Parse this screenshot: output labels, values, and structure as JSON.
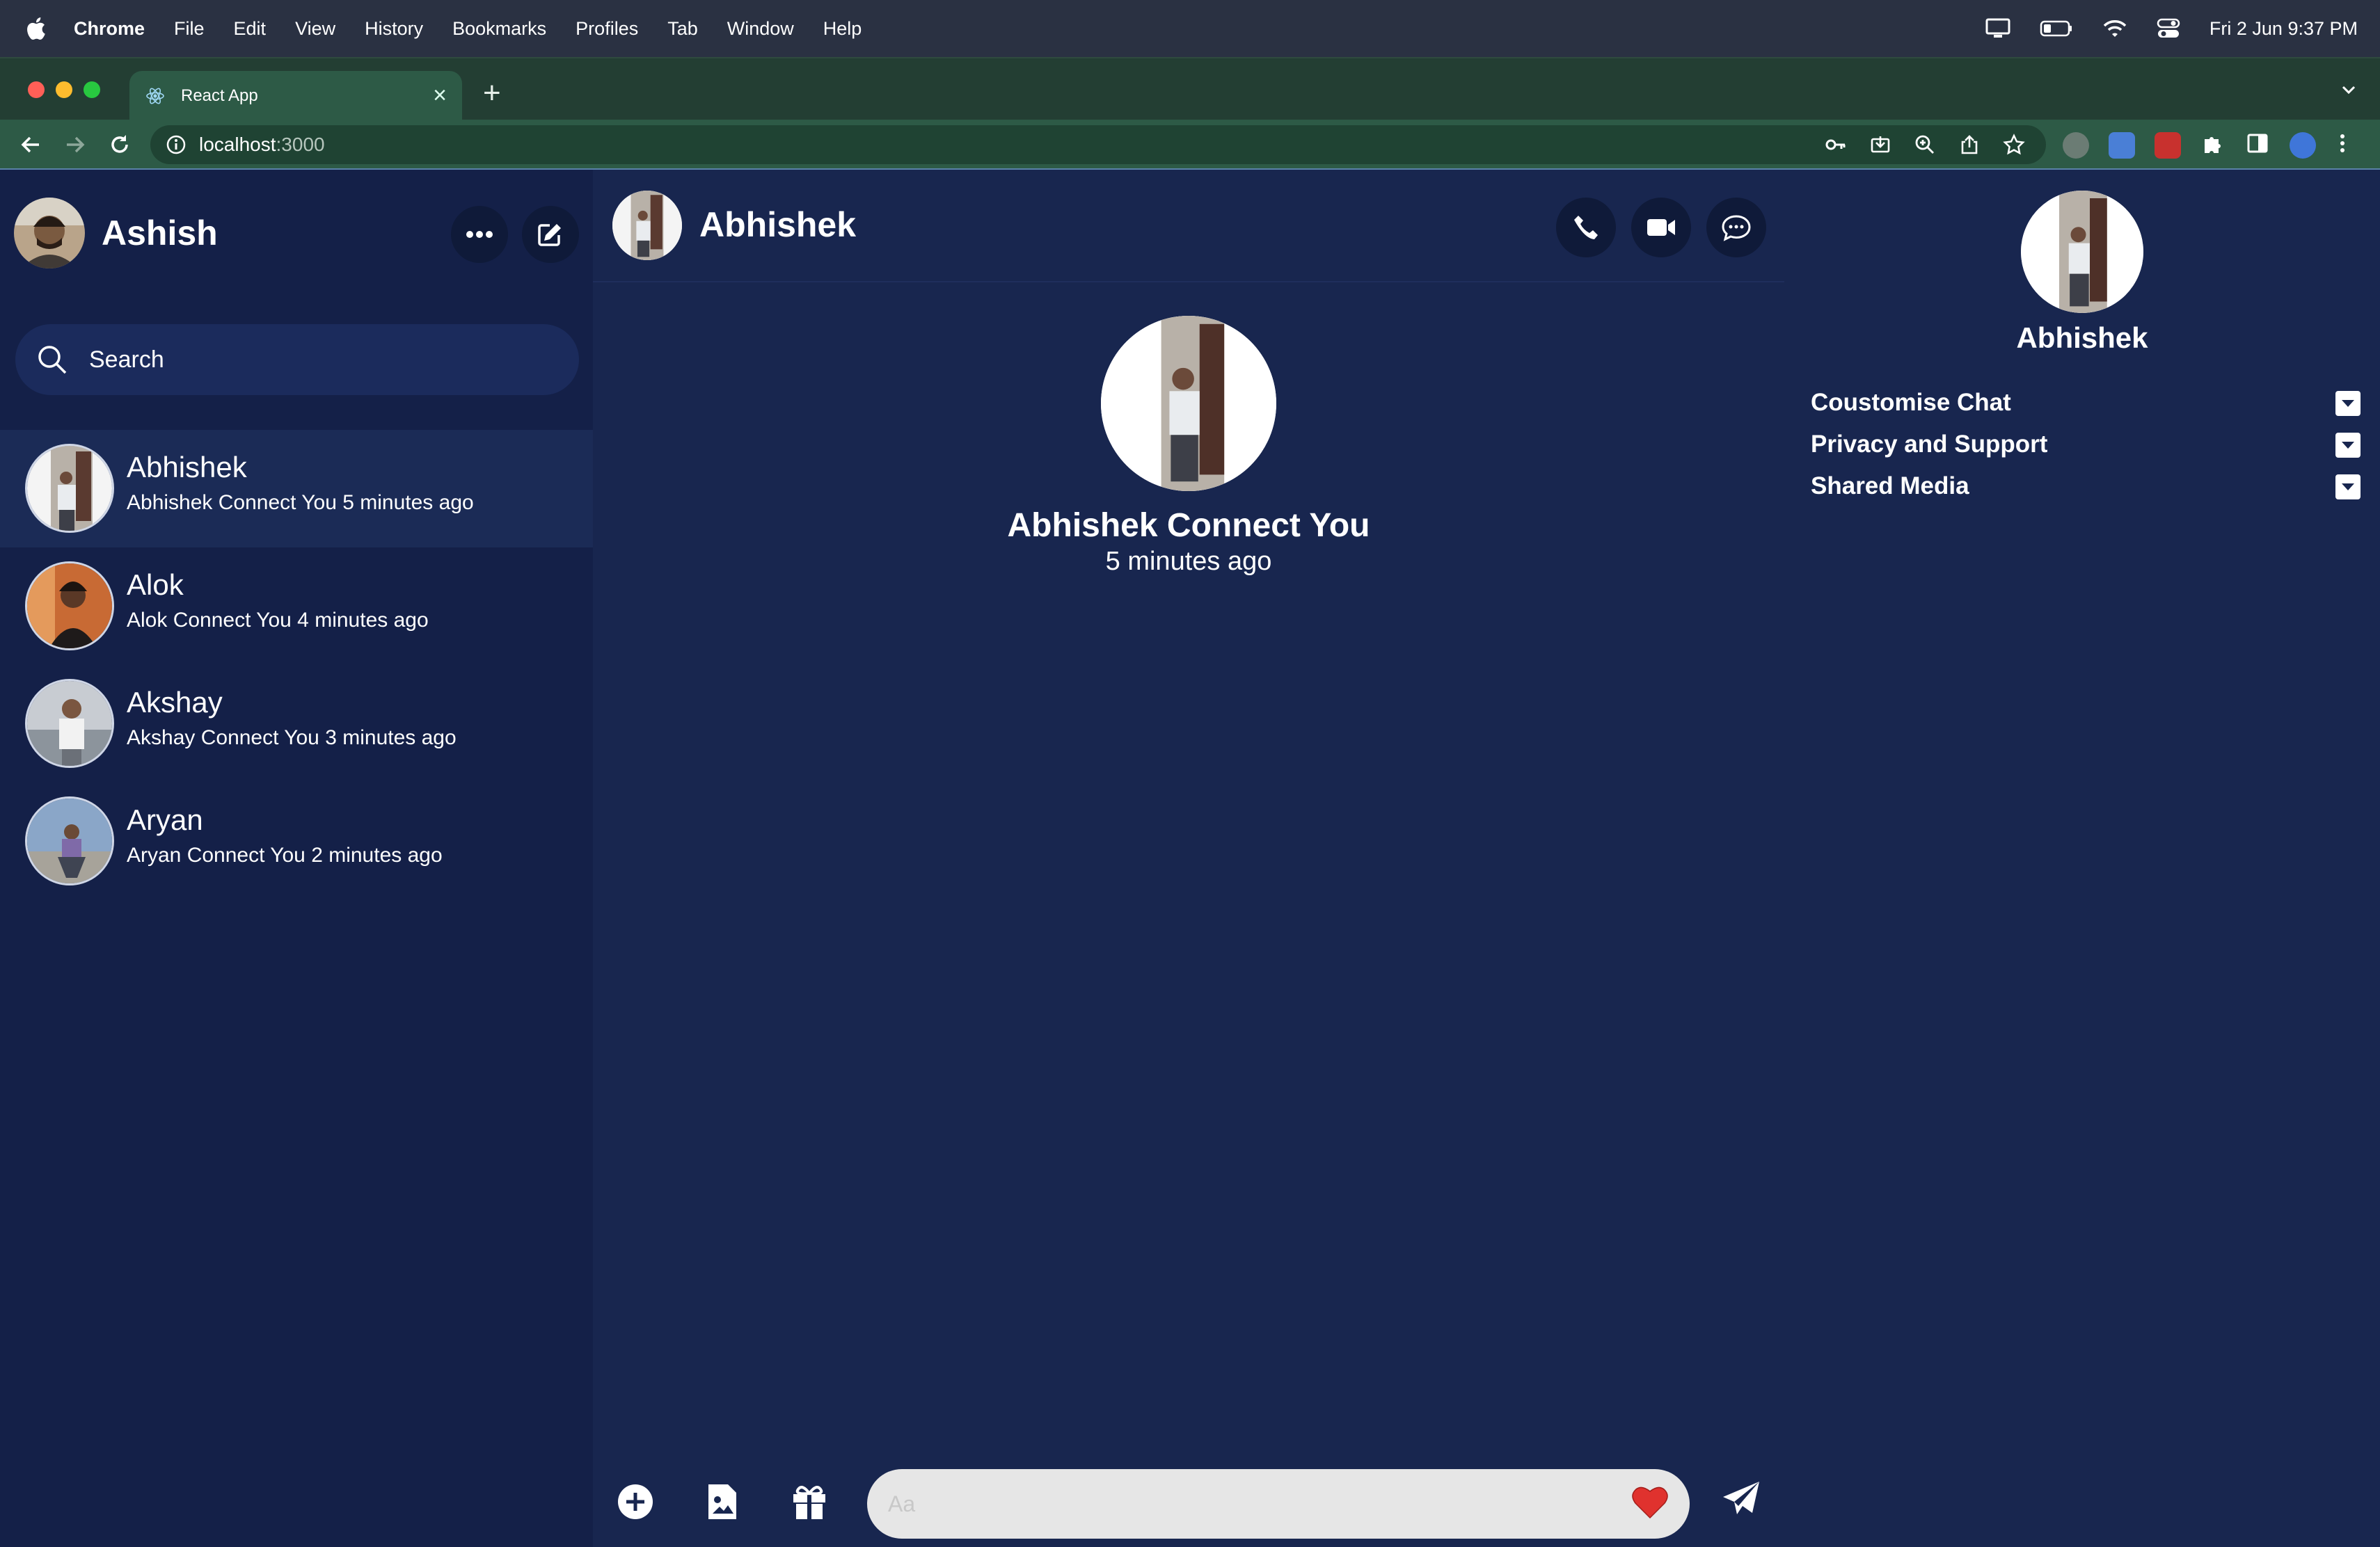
{
  "menubar": {
    "app_name": "Chrome",
    "items": [
      "File",
      "Edit",
      "View",
      "History",
      "Bookmarks",
      "Profiles",
      "Tab",
      "Window",
      "Help"
    ],
    "clock": "Fri 2 Jun  9:37 PM"
  },
  "browser": {
    "tab_title": "React App",
    "url_host": "localhost",
    "url_port": ":3000"
  },
  "sidebar": {
    "user_name": "Ashish",
    "search_placeholder": "Search",
    "contacts": [
      {
        "name": "Abhishek",
        "message": "Abhishek Connect You 5 minutes ago"
      },
      {
        "name": "Alok",
        "message": "Alok Connect You 4 minutes ago"
      },
      {
        "name": "Akshay",
        "message": "Akshay Connect You 3 minutes ago"
      },
      {
        "name": "Aryan",
        "message": "Aryan Connect You 2 minutes ago"
      }
    ]
  },
  "chat": {
    "contact_name": "Abhishek",
    "intro_title": "Abhishek Connect You",
    "intro_time": "5 minutes ago",
    "input_placeholder": "Aa"
  },
  "details": {
    "name": "Abhishek",
    "sections": [
      "Coustomise Chat",
      "Privacy and Support",
      "Shared Media"
    ]
  },
  "colors": {
    "app_bg": "#18264f",
    "sidebar_bg": "#142048",
    "active_row": "#1b2b56",
    "chrome_green": "#2d5a46"
  }
}
